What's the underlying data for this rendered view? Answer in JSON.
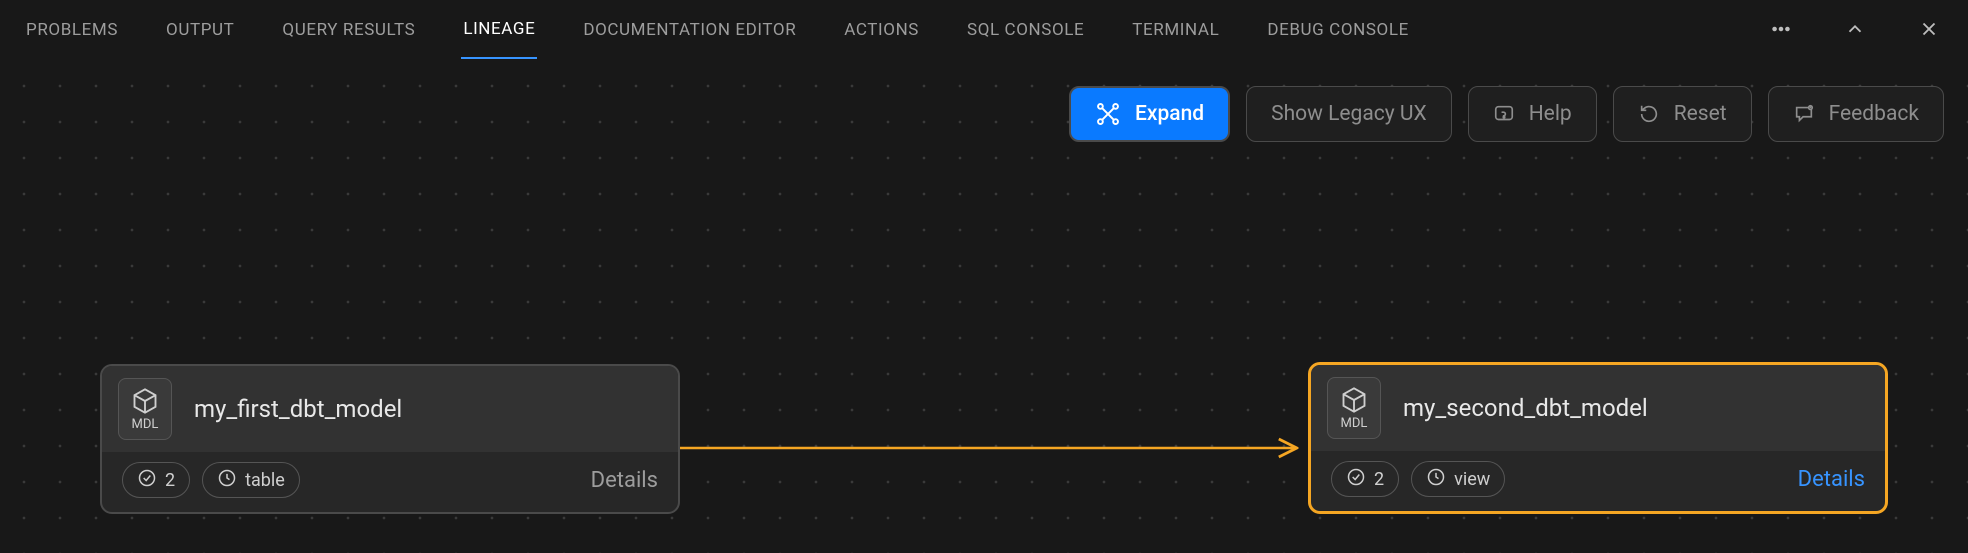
{
  "tabs": [
    {
      "label": "PROBLEMS",
      "active": false
    },
    {
      "label": "OUTPUT",
      "active": false
    },
    {
      "label": "QUERY RESULTS",
      "active": false
    },
    {
      "label": "LINEAGE",
      "active": true
    },
    {
      "label": "DOCUMENTATION EDITOR",
      "active": false
    },
    {
      "label": "ACTIONS",
      "active": false
    },
    {
      "label": "SQL CONSOLE",
      "active": false
    },
    {
      "label": "TERMINAL",
      "active": false
    },
    {
      "label": "DEBUG CONSOLE",
      "active": false
    }
  ],
  "toolbar": {
    "expand": "Expand",
    "legacy": "Show Legacy UX",
    "help": "Help",
    "reset": "Reset",
    "feedback": "Feedback"
  },
  "nodes": [
    {
      "badge": "MDL",
      "title": "my_first_dbt_model",
      "test_count": "2",
      "materialization": "table",
      "details_label": "Details",
      "selected": false
    },
    {
      "badge": "MDL",
      "title": "my_second_dbt_model",
      "test_count": "2",
      "materialization": "view",
      "details_label": "Details",
      "selected": true
    }
  ],
  "colors": {
    "accent": "#3794ff",
    "primary_button": "#0a7aff",
    "selected_border": "#f5a623",
    "edge": "#f5a623"
  }
}
